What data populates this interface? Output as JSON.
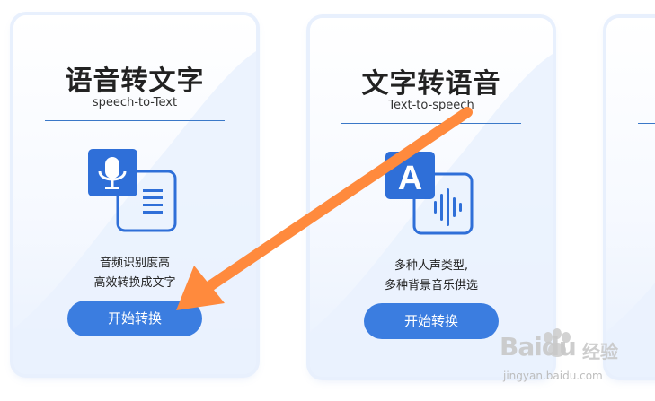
{
  "cards": [
    {
      "title": "语音转文字",
      "subtitle": "speech-to-Text",
      "icon": "microphone-to-document-icon",
      "desc_line1": "音频识别度高",
      "desc_line2": "高效转换成文字",
      "button_label": "开始转换"
    },
    {
      "title": "文字转语音",
      "subtitle": "Text-to-speech",
      "icon": "text-to-audio-icon",
      "desc_line1": "多种人声类型,",
      "desc_line2": "多种背景音乐供选",
      "button_label": "开始转换"
    },
    {
      "title": "",
      "subtitle": "",
      "desc_line1": "",
      "desc_line2": "",
      "button_label": ""
    }
  ],
  "annotation": {
    "arrow_color": "#ff8a3d"
  },
  "watermark": {
    "brand": "Baidu",
    "brand_suffix": "经验",
    "url": "jingyan.baidu.com"
  },
  "colors": {
    "accent": "#3b7de0",
    "icon_blue": "#2f6fd8",
    "divider": "#3a78c8"
  }
}
